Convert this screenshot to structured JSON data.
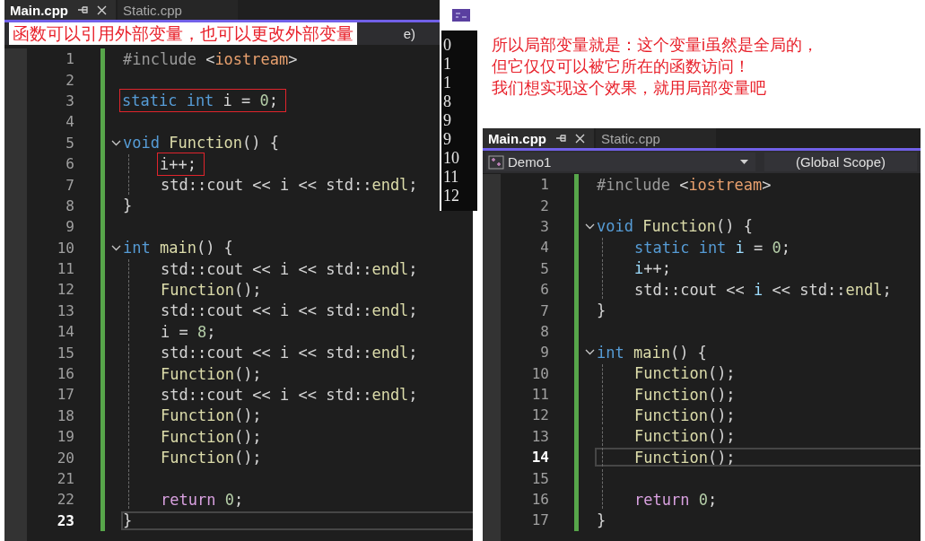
{
  "left_editor": {
    "tabs": [
      {
        "label": "Main.cpp",
        "selected": true
      },
      {
        "label": "Static.cpp",
        "selected": false
      }
    ],
    "nav_tail": "e)",
    "lines": [
      {
        "n": "1",
        "tokens": [
          {
            "kind": "pre",
            "t": "#include "
          },
          {
            "kind": "pl",
            "t": "<"
          },
          {
            "kind": "str",
            "t": "iostream"
          },
          {
            "kind": "pl",
            "t": ">"
          }
        ]
      },
      {
        "n": "2"
      },
      {
        "n": "3",
        "boxed": true,
        "tokens": [
          {
            "kind": "kw",
            "t": "static int "
          },
          {
            "kind": "pl",
            "t": "i = "
          },
          {
            "kind": "num",
            "t": "0"
          },
          {
            "kind": "pl",
            "t": ";"
          }
        ]
      },
      {
        "n": "4"
      },
      {
        "n": "5",
        "fold": true,
        "tokens": [
          {
            "kind": "kw",
            "t": "void "
          },
          {
            "kind": "fn",
            "t": "Function"
          },
          {
            "kind": "pl",
            "t": "() {"
          }
        ]
      },
      {
        "n": "6",
        "indented": true,
        "boxed": true,
        "tokens": [
          {
            "kind": "pl",
            "t": "i++;"
          }
        ]
      },
      {
        "n": "7",
        "indented": true,
        "tokens": [
          {
            "kind": "pl",
            "t": "std::cout << i << std::"
          },
          {
            "kind": "fn",
            "t": "endl"
          },
          {
            "kind": "pl",
            "t": ";"
          }
        ]
      },
      {
        "n": "8",
        "tokens": [
          {
            "kind": "pl",
            "t": "}"
          }
        ]
      },
      {
        "n": "9"
      },
      {
        "n": "10",
        "fold": true,
        "tokens": [
          {
            "kind": "kw",
            "t": "int "
          },
          {
            "kind": "fn",
            "t": "main"
          },
          {
            "kind": "pl",
            "t": "() {"
          }
        ]
      },
      {
        "n": "11",
        "indented": true,
        "tokens": [
          {
            "kind": "pl",
            "t": "std::cout << i << std::"
          },
          {
            "kind": "fn",
            "t": "endl"
          },
          {
            "kind": "pl",
            "t": ";"
          }
        ]
      },
      {
        "n": "12",
        "indented": true,
        "tokens": [
          {
            "kind": "fn",
            "t": "Function"
          },
          {
            "kind": "pl",
            "t": "();"
          }
        ]
      },
      {
        "n": "13",
        "indented": true,
        "tokens": [
          {
            "kind": "pl",
            "t": "std::cout << i << std::"
          },
          {
            "kind": "fn",
            "t": "endl"
          },
          {
            "kind": "pl",
            "t": ";"
          }
        ]
      },
      {
        "n": "14",
        "indented": true,
        "tokens": [
          {
            "kind": "pl",
            "t": "i = "
          },
          {
            "kind": "num",
            "t": "8"
          },
          {
            "kind": "pl",
            "t": ";"
          }
        ]
      },
      {
        "n": "15",
        "indented": true,
        "tokens": [
          {
            "kind": "pl",
            "t": "std::cout << i << std::"
          },
          {
            "kind": "fn",
            "t": "endl"
          },
          {
            "kind": "pl",
            "t": ";"
          }
        ]
      },
      {
        "n": "16",
        "indented": true,
        "tokens": [
          {
            "kind": "fn",
            "t": "Function"
          },
          {
            "kind": "pl",
            "t": "();"
          }
        ]
      },
      {
        "n": "17",
        "indented": true,
        "tokens": [
          {
            "kind": "pl",
            "t": "std::cout << i << std::"
          },
          {
            "kind": "fn",
            "t": "endl"
          },
          {
            "kind": "pl",
            "t": ";"
          }
        ]
      },
      {
        "n": "18",
        "indented": true,
        "tokens": [
          {
            "kind": "fn",
            "t": "Function"
          },
          {
            "kind": "pl",
            "t": "();"
          }
        ]
      },
      {
        "n": "19",
        "indented": true,
        "tokens": [
          {
            "kind": "fn",
            "t": "Function"
          },
          {
            "kind": "pl",
            "t": "();"
          }
        ]
      },
      {
        "n": "20",
        "indented": true,
        "tokens": [
          {
            "kind": "fn",
            "t": "Function"
          },
          {
            "kind": "pl",
            "t": "();"
          }
        ]
      },
      {
        "n": "21",
        "indented": true
      },
      {
        "n": "22",
        "indented": true,
        "tokens": [
          {
            "kind": "ctl",
            "t": "return "
          },
          {
            "kind": "num",
            "t": "0"
          },
          {
            "kind": "pl",
            "t": ";"
          }
        ]
      },
      {
        "n": "23",
        "current": true,
        "tokens": [
          {
            "kind": "pl",
            "t": "}"
          }
        ]
      }
    ]
  },
  "left_note": "函数可以引用外部变量，也可以更改外部变量",
  "console": {
    "output": [
      "0",
      "1",
      "1",
      "8",
      "9",
      "9",
      "10",
      "11",
      "12"
    ]
  },
  "right_note": [
    "所以局部变量就是：这个变量i虽然是全局的，",
    "但它仅仅可以被它所在的函数访问！",
    "我们想实现这个效果，就用局部变量吧"
  ],
  "right_editor": {
    "tabs": [
      {
        "label": "Main.cpp",
        "selected": true
      },
      {
        "label": "Static.cpp",
        "selected": false
      }
    ],
    "project": "Demo1",
    "scope": "(Global Scope)",
    "lines": [
      {
        "n": "1",
        "tokens": [
          {
            "kind": "pre",
            "t": "#include "
          },
          {
            "kind": "pl",
            "t": "<"
          },
          {
            "kind": "str",
            "t": "iostream"
          },
          {
            "kind": "pl",
            "t": ">"
          }
        ]
      },
      {
        "n": "2"
      },
      {
        "n": "3",
        "fold": true,
        "tokens": [
          {
            "kind": "kw",
            "t": "void "
          },
          {
            "kind": "fn",
            "t": "Function"
          },
          {
            "kind": "pl",
            "t": "() {"
          }
        ]
      },
      {
        "n": "4",
        "indented": true,
        "tokens": [
          {
            "kind": "kw",
            "t": "static int "
          },
          {
            "kind": "var",
            "t": "i"
          },
          {
            "kind": "pl",
            "t": " = "
          },
          {
            "kind": "num",
            "t": "0"
          },
          {
            "kind": "pl",
            "t": ";"
          }
        ]
      },
      {
        "n": "5",
        "indented": true,
        "tokens": [
          {
            "kind": "var",
            "t": "i"
          },
          {
            "kind": "pl",
            "t": "++;"
          }
        ]
      },
      {
        "n": "6",
        "indented": true,
        "tokens": [
          {
            "kind": "pl",
            "t": "std::cout << "
          },
          {
            "kind": "var",
            "t": "i"
          },
          {
            "kind": "pl",
            "t": " << std::"
          },
          {
            "kind": "fn",
            "t": "endl"
          },
          {
            "kind": "pl",
            "t": ";"
          }
        ]
      },
      {
        "n": "7",
        "tokens": [
          {
            "kind": "pl",
            "t": "}"
          }
        ]
      },
      {
        "n": "8"
      },
      {
        "n": "9",
        "fold": true,
        "tokens": [
          {
            "kind": "kw",
            "t": "int "
          },
          {
            "kind": "fn",
            "t": "main"
          },
          {
            "kind": "pl",
            "t": "() {"
          }
        ]
      },
      {
        "n": "10",
        "indented": true,
        "tokens": [
          {
            "kind": "fn",
            "t": "Function"
          },
          {
            "kind": "pl",
            "t": "();"
          }
        ]
      },
      {
        "n": "11",
        "indented": true,
        "tokens": [
          {
            "kind": "fn",
            "t": "Function"
          },
          {
            "kind": "pl",
            "t": "();"
          }
        ]
      },
      {
        "n": "12",
        "indented": true,
        "tokens": [
          {
            "kind": "fn",
            "t": "Function"
          },
          {
            "kind": "pl",
            "t": "();"
          }
        ]
      },
      {
        "n": "13",
        "indented": true,
        "tokens": [
          {
            "kind": "fn",
            "t": "Function"
          },
          {
            "kind": "pl",
            "t": "();"
          }
        ]
      },
      {
        "n": "14",
        "indented": true,
        "current": true,
        "tokens": [
          {
            "kind": "fn",
            "t": "Function"
          },
          {
            "kind": "pl",
            "t": "();"
          }
        ]
      },
      {
        "n": "15",
        "indented": true
      },
      {
        "n": "16",
        "indented": true,
        "tokens": [
          {
            "kind": "ctl",
            "t": "return "
          },
          {
            "kind": "num",
            "t": "0"
          },
          {
            "kind": "pl",
            "t": ";"
          }
        ]
      },
      {
        "n": "17",
        "tokens": [
          {
            "kind": "pl",
            "t": "}"
          }
        ]
      }
    ]
  }
}
